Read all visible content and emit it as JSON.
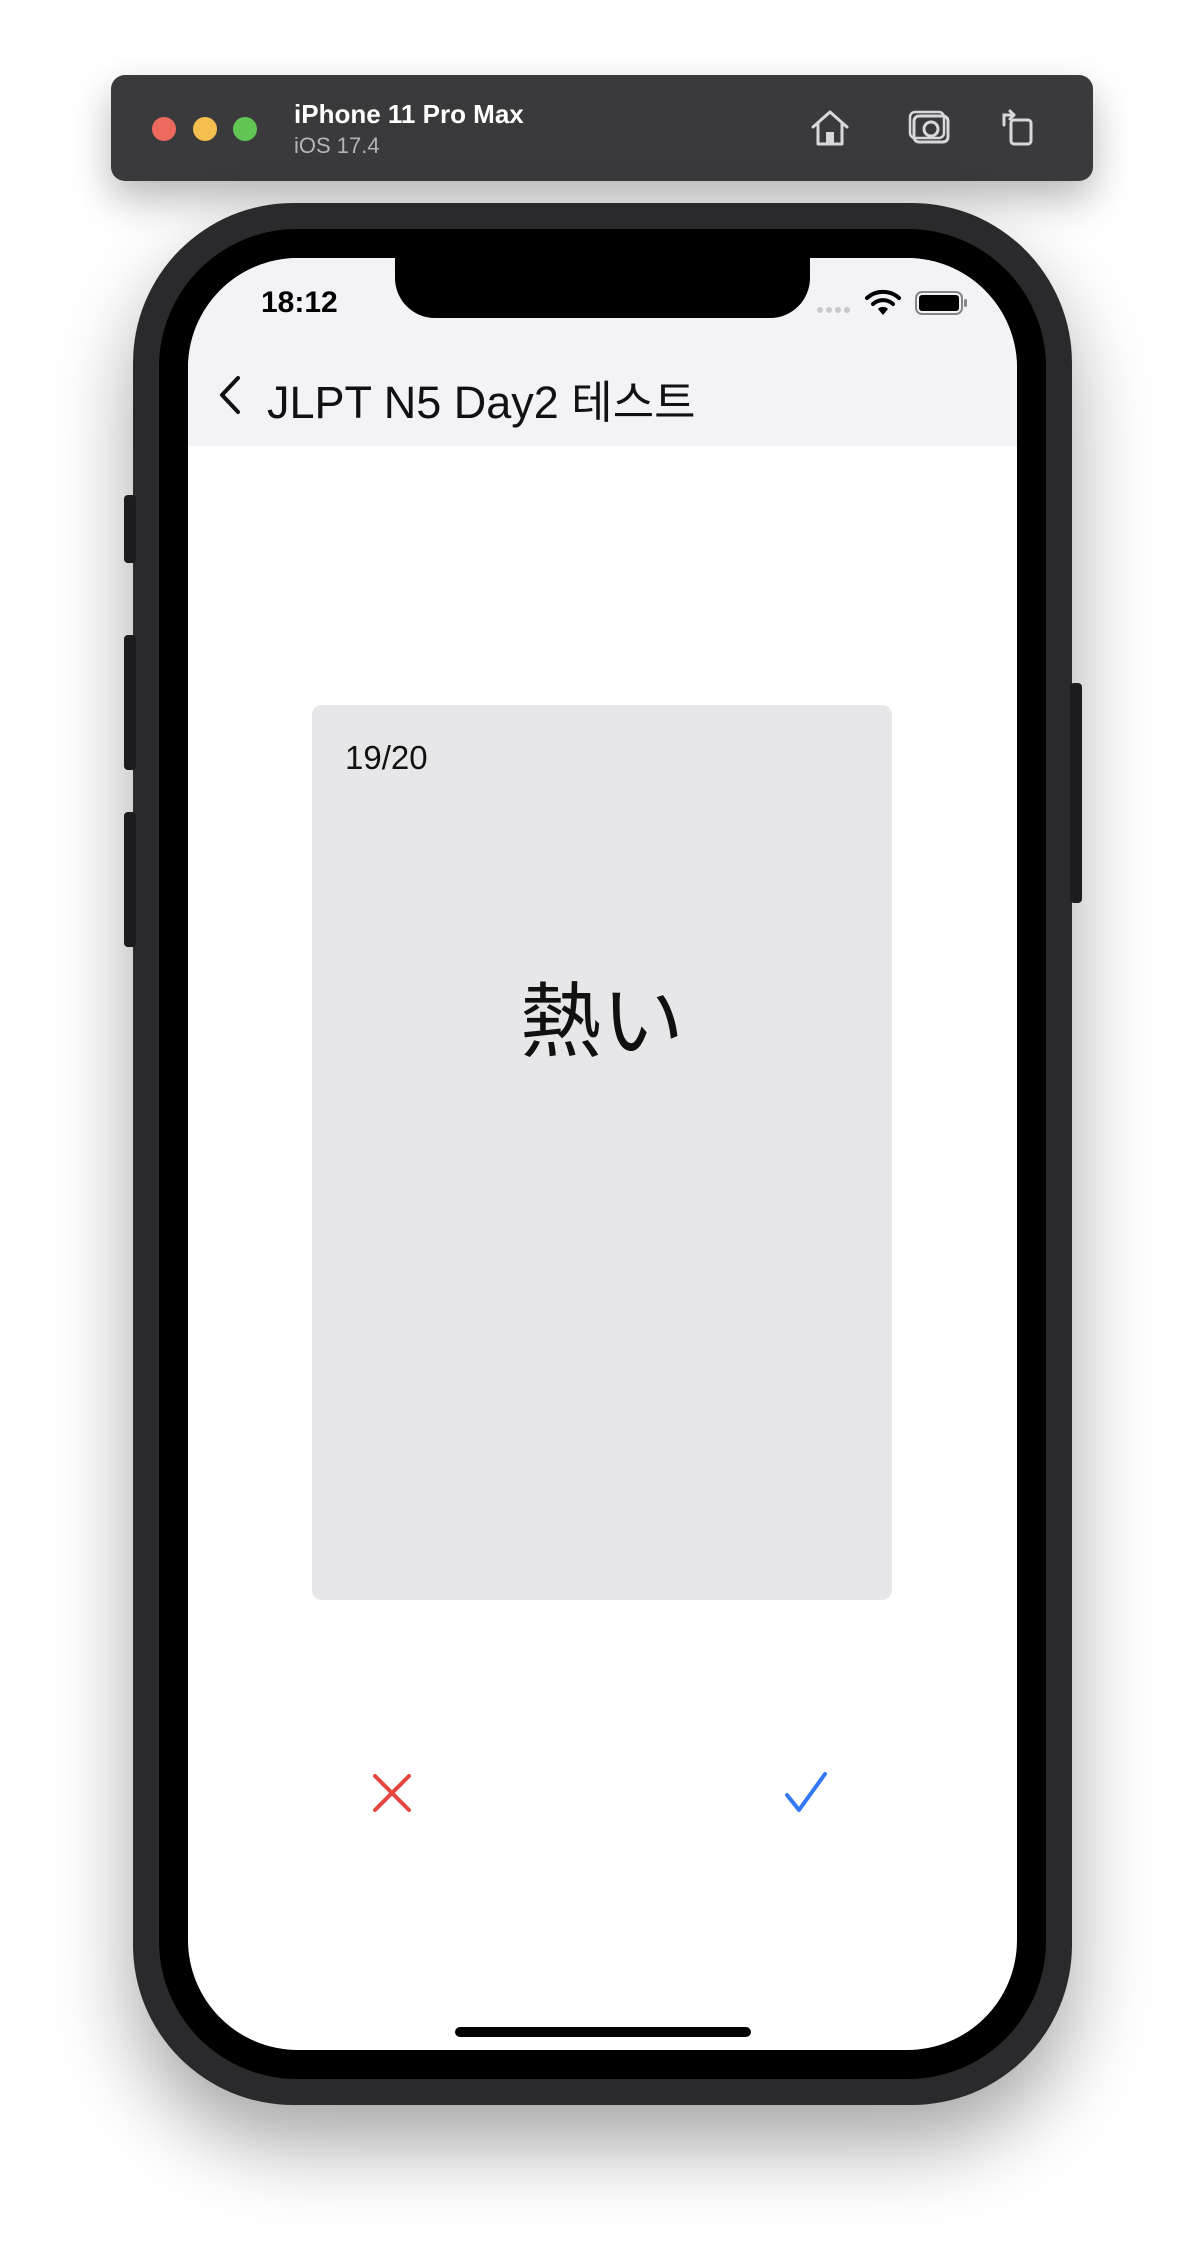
{
  "simulator": {
    "device_name": "iPhone 11 Pro Max",
    "os_version": "iOS 17.4",
    "toolbar_icons": [
      "home-icon",
      "screenshot-icon",
      "rotate-icon"
    ]
  },
  "status_bar": {
    "time": "18:12",
    "icons": [
      "signal-icon",
      "wifi-icon",
      "battery-icon"
    ]
  },
  "nav": {
    "back_icon": "chevron-left-icon",
    "title": "JLPT N5 Day2 테스트"
  },
  "card": {
    "progress": "19/20",
    "word": "熱い"
  },
  "actions": {
    "wrong_icon": "x-icon",
    "right_icon": "checkmark-icon",
    "wrong_color": "#e5483f",
    "right_color": "#3478f6"
  }
}
